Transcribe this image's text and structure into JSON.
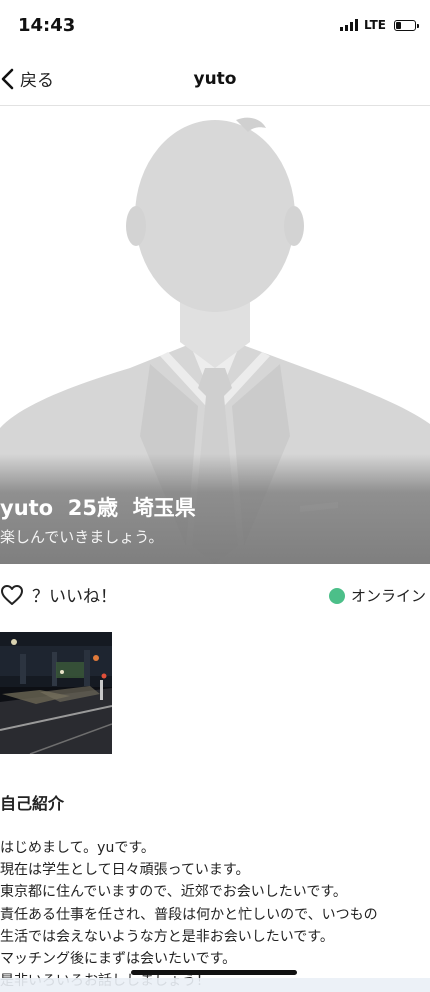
{
  "status_bar": {
    "time": "14:43",
    "network": "LTE",
    "battery_level": 0.3
  },
  "nav": {
    "back_label": "戻る",
    "title": "yuto"
  },
  "profile": {
    "name_line": "yuto  25歳  埼玉県",
    "tagline": "楽しんでいきましょう。",
    "like_label": "？いいね！",
    "online_label": "オンライン",
    "online_color": "#4cbf89"
  },
  "photos": [
    {
      "icon": "night-street-photo"
    }
  ],
  "intro": {
    "heading": "自己紹介",
    "lines": [
      "はじめまして。yuです。",
      "現在は学生として日々頑張っています。",
      "東京都に住んでいますので、近郊でお会いしたいです。",
      "責任ある仕事を任され、普段は何かと忙しいので、いつもの",
      "生活では会えないような方と是非お会いしたいです。",
      "マッチング後にまずは会いたいです。",
      "是非いろいろお話ししましょう！"
    ]
  }
}
